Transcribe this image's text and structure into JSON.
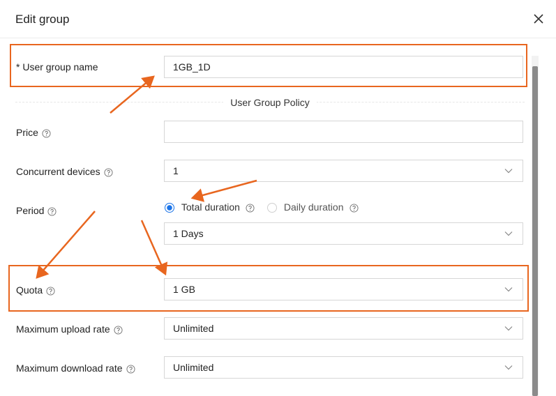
{
  "dialog": {
    "title": "Edit group",
    "close_icon": "close-icon"
  },
  "form": {
    "group_name": {
      "required_mark": "*",
      "label": "User group name",
      "value": "1GB_1D"
    },
    "section_title": "User Group Policy",
    "price": {
      "label": "Price",
      "value": ""
    },
    "concurrent_devices": {
      "label": "Concurrent devices",
      "value": "1"
    },
    "period": {
      "label": "Period",
      "options": [
        {
          "label": "Total duration",
          "selected": true
        },
        {
          "label": "Daily duration",
          "selected": false
        }
      ],
      "value": "1 Days"
    },
    "quota": {
      "label": "Quota",
      "value": "1 GB"
    },
    "max_upload": {
      "label": "Maximum upload rate",
      "value": "Unlimited"
    },
    "max_download": {
      "label": "Maximum download rate",
      "value": "Unlimited"
    }
  },
  "annotation_color": "#e8661f",
  "accent_color": "#1a73e8"
}
